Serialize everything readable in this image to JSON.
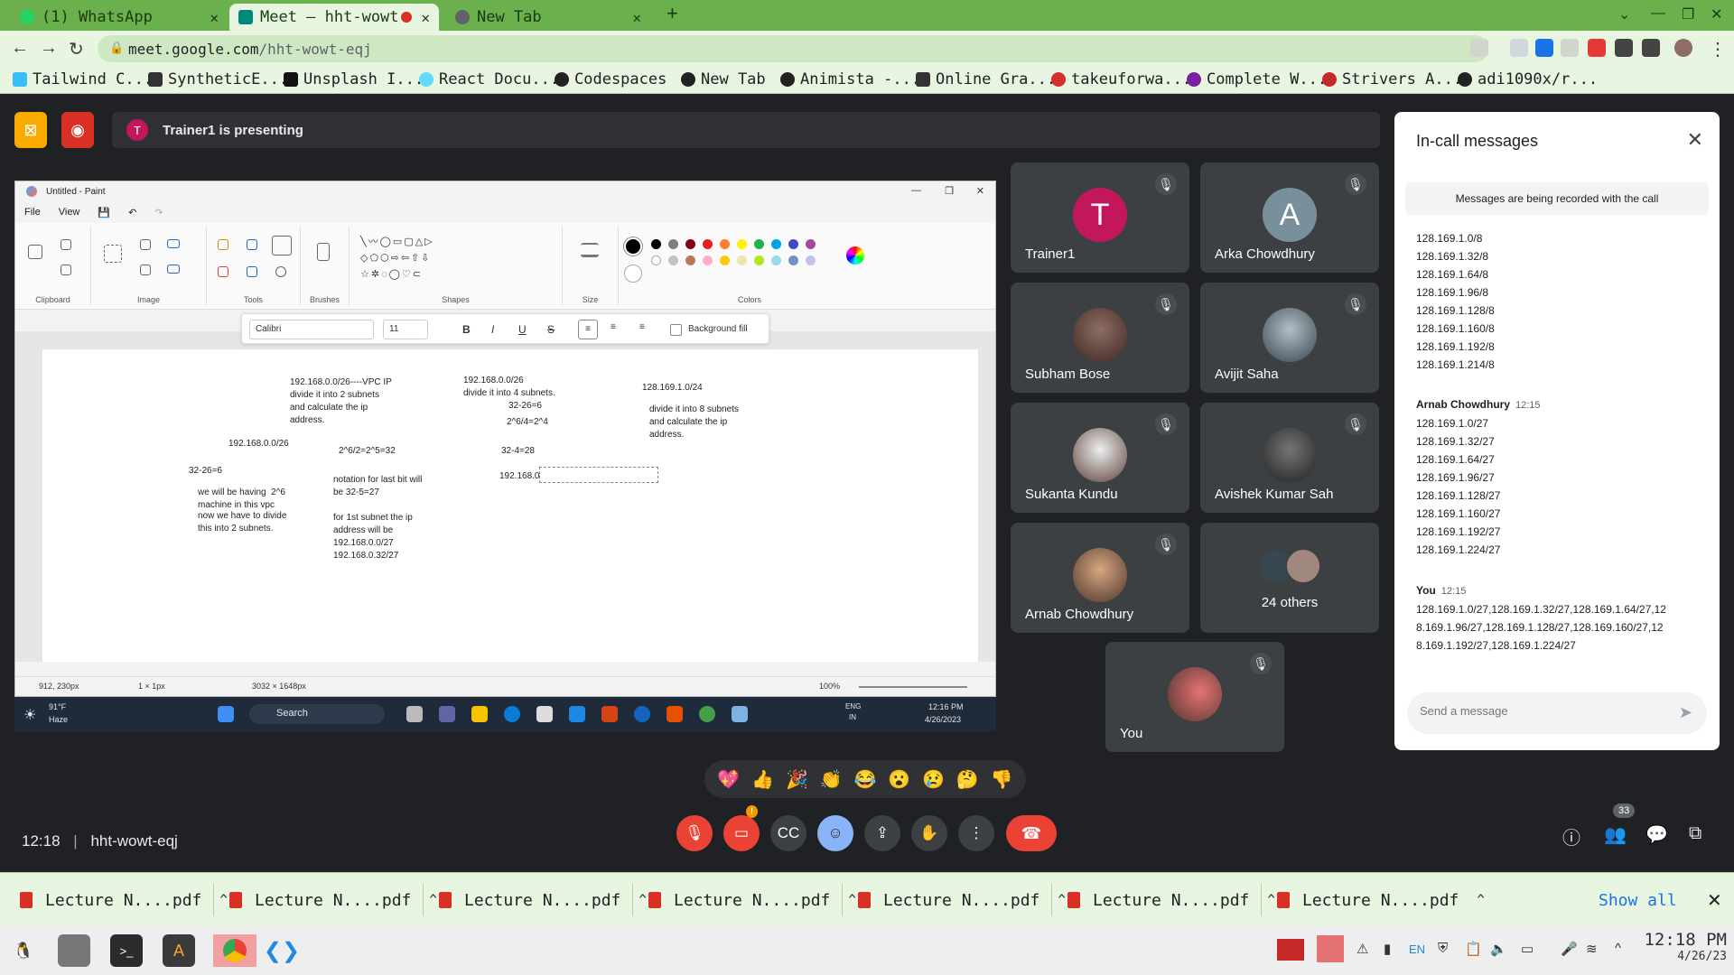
{
  "browser": {
    "tabs": [
      {
        "title": "(1) WhatsApp",
        "active": false
      },
      {
        "title": "Meet – hht-wowt",
        "active": true,
        "recording": true
      },
      {
        "title": "New Tab",
        "active": false
      }
    ],
    "url_host": "meet.google.com",
    "url_path": "/hht-wowt-eqj",
    "bookmarks": [
      "Tailwind C...",
      "SyntheticE...",
      "Unsplash I...",
      "React Docu...",
      "Codespaces",
      "New Tab",
      "Animista -...",
      "Online Gra...",
      "takeuforwa...",
      "Complete W...",
      "Strivers A...",
      "adi1090x/r..."
    ]
  },
  "meet": {
    "presenting_initial": "T",
    "presenting_text": "Trainer1 is presenting",
    "meeting_time": "12:18",
    "meeting_code": "hht-wowt-eqj",
    "participant_count": "33",
    "cam_warning": "!"
  },
  "paint": {
    "title": "Untitled - Paint",
    "menu": [
      "File",
      "View"
    ],
    "groups": [
      "Clipboard",
      "Image",
      "Tools",
      "Brushes",
      "Shapes",
      "Size",
      "Colors"
    ],
    "font": "Calibri",
    "font_size": "11",
    "bg_fill_label": "Background fill",
    "status_pos": "912, 230px",
    "status_sel": "1 × 1px",
    "status_size": "3032 × 1648px",
    "zoom": "100%",
    "notes": [
      "192.168.0.0/26----VPC IP\ndivide it into 2 subnets\nand calculate the ip\naddress.",
      "192.168.0.0/26\ndivide it into 4 subnets.",
      "128.169.1.0/24",
      "32-26=6",
      "2^6/4=2^4",
      "divide it into 8 subnets\nand calculate the ip\naddress.",
      "192.168.0.0/26",
      "2^6/2=2^5=32",
      "32-4=28",
      "32-26=6",
      "notation for last bit will\nbe 32-5=27",
      "192.168.0",
      "we will be having  2^6\nmachine in this vpc",
      "now we have to divide\nthis into 2 subnets.",
      "for 1st subnet the ip\naddress will be\n192.168.0.0/27\n192.168.0.32/27"
    ],
    "colors": [
      "#000000",
      "#7f7f7f",
      "#880015",
      "#ed1c24",
      "#ff7f27",
      "#fff200",
      "#22b14c",
      "#00a2e8",
      "#3f48cc",
      "#a349a4"
    ],
    "colors2": [
      "#ffffff",
      "#c3c3c3",
      "#b97a57",
      "#ffaec9",
      "#ffc90e",
      "#efe4b0",
      "#b5e61d",
      "#99d9ea",
      "#7092be",
      "#c8bfe7"
    ]
  },
  "windows_taskbar": {
    "weather_temp": "91°F",
    "weather_text": "Haze",
    "search": "Search",
    "lang": "ENG",
    "region": "IN",
    "time": "12:16 PM",
    "date": "4/26/2023"
  },
  "tiles": [
    {
      "name": "Trainer1",
      "initial": "T",
      "color": "#c2185b"
    },
    {
      "name": "Arka Chowdhury",
      "initial": "A",
      "color": "#78909c"
    },
    {
      "name": "Subham Bose"
    },
    {
      "name": "Avijit Saha"
    },
    {
      "name": "Sukanta Kundu"
    },
    {
      "name": "Avishek Kumar Sah"
    },
    {
      "name": "Arnab Chowdhury"
    },
    {
      "name": "24 others"
    },
    {
      "name": "You"
    }
  ],
  "chat": {
    "title": "In-call messages",
    "recording_note": "Messages are being recorded with the call",
    "messages": [
      {
        "author": "",
        "time": "",
        "lines": [
          "128.169.1.0/8",
          "128.169.1.32/8",
          "128.169.1.64/8",
          "128.169.1.96/8",
          "128.169.1.128/8",
          "128.169.1.160/8",
          "128.169.1.192/8",
          "128.169.1.214/8"
        ]
      },
      {
        "author": "Arnab Chowdhury",
        "time": "12:15",
        "lines": [
          "128.169.1.0/27",
          "128.169.1.32/27",
          "128.169.1.64/27",
          "128.169.1.96/27",
          "128.169.1.128/27",
          "128.169.1.160/27",
          "128.169.1.192/27",
          "128.169.1.224/27"
        ]
      },
      {
        "author": "You",
        "time": "12:15",
        "lines": [
          "128.169.1.0/27,128.169.1.32/27,128.169.1.64/27,12",
          "8.169.1.96/27,128.169.1.128/27,128.169.160/27,12",
          "8.169.1.192/27,128.169.1.224/27"
        ]
      }
    ],
    "input_placeholder": "Send a message"
  },
  "reactions": [
    "💖",
    "👍",
    "🎉",
    "👏",
    "😂",
    "😮",
    "😢",
    "🤔",
    "👎"
  ],
  "downloads": {
    "items": [
      "Lecture N....pdf",
      "Lecture N....pdf",
      "Lecture N....pdf",
      "Lecture N....pdf",
      "Lecture N....pdf",
      "Lecture N....pdf",
      "Lecture N....pdf"
    ],
    "show_all": "Show all"
  },
  "os_taskbar": {
    "lang": "EN",
    "time": "12:18 PM",
    "date": "4/26/23"
  }
}
